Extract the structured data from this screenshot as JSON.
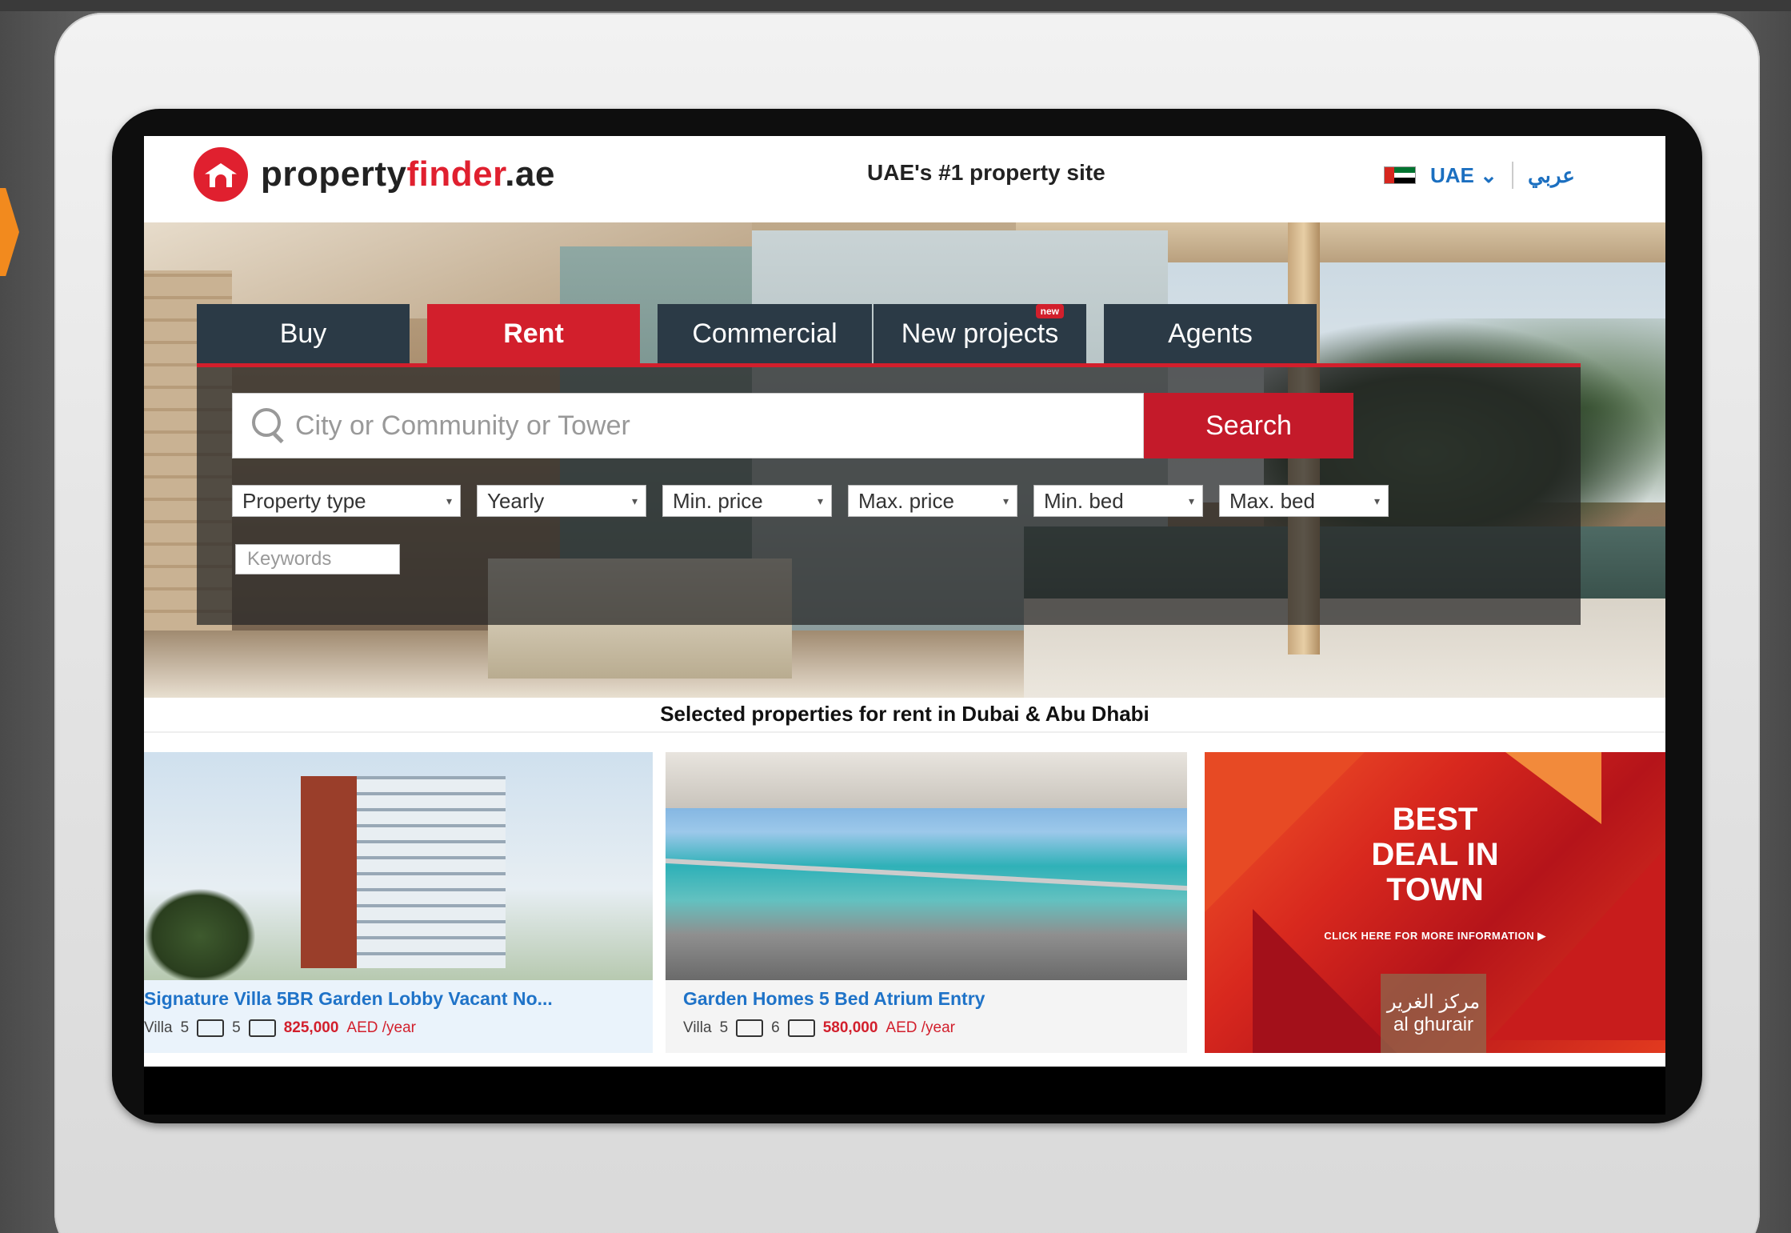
{
  "header": {
    "logo_part1": "property",
    "logo_part2": "finder",
    "logo_part3": ".ae",
    "tagline": "UAE's #1 property site",
    "country": "UAE",
    "language_link": "عربي"
  },
  "tabs": [
    {
      "label": "Buy",
      "active": false
    },
    {
      "label": "Rent",
      "active": true
    },
    {
      "label": "Commercial",
      "active": false
    },
    {
      "label": "New projects",
      "active": false,
      "badge": "new"
    },
    {
      "label": "Agents",
      "active": false
    }
  ],
  "search": {
    "placeholder": "City or Community or Tower",
    "button_label": "Search"
  },
  "filters": {
    "property_type": "Property type",
    "period": "Yearly",
    "min_price": "Min. price",
    "max_price": "Max. price",
    "min_bed": "Min. bed",
    "max_bed": "Max. bed",
    "keywords_placeholder": "Keywords"
  },
  "section_title": "Selected properties for rent in Dubai & Abu Dhabi",
  "listings": [
    {
      "title": "Signature Villa 5BR Garden Lobby Vacant No...",
      "type": "Villa",
      "beds": "5",
      "baths": "5",
      "price": "825,000",
      "unit": "AED /year"
    },
    {
      "title": "Garden Homes 5 Bed Atrium Entry",
      "type": "Villa",
      "beds": "5",
      "baths": "6",
      "price": "580,000",
      "unit": "AED /year"
    }
  ],
  "ad": {
    "headline": "BEST\nDEAL IN\nTOWN",
    "cta": "CLICK HERE FOR MORE INFORMATION ▶",
    "brand_ar": "مركز الغرير",
    "brand_en": "al ghurair"
  },
  "colors": {
    "brand_red": "#d21f2c",
    "tab_dark": "#2b3a46",
    "link_blue": "#1f73c8"
  }
}
